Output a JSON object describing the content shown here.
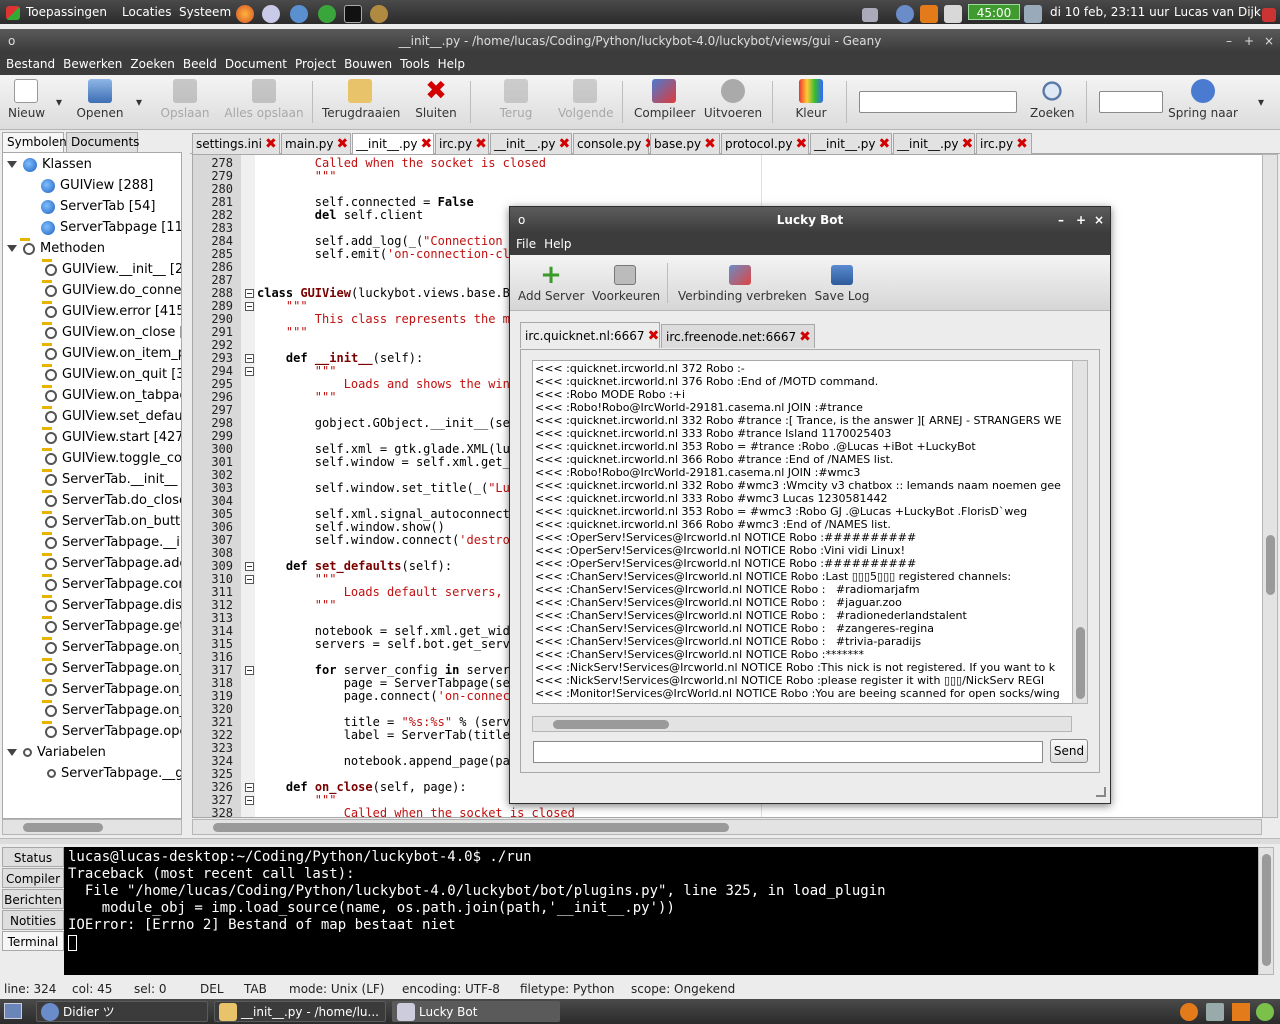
{
  "top_panel": {
    "menus": [
      "Toepassingen",
      "Locaties",
      "Systeem"
    ],
    "battery": "45:00",
    "clock": "di 10 feb, 23:11 uur",
    "user": "Lucas van Dijk"
  },
  "geany": {
    "title": "__init__.py - /home/lucas/Coding/Python/luckybot-4.0/luckybot/views/gui - Geany",
    "menu": [
      "Bestand",
      "Bewerken",
      "Zoeken",
      "Beeld",
      "Document",
      "Project",
      "Bouwen",
      "Tools",
      "Help"
    ],
    "toolbar": {
      "nieuw": "Nieuw",
      "openen": "Openen",
      "opslaan": "Opslaan",
      "alles_opslaan": "Alles opslaan",
      "terugdraaien": "Terugdraaien",
      "sluiten": "Sluiten",
      "terug": "Terug",
      "volgende": "Volgende",
      "compileer": "Compileer",
      "uitvoeren": "Uitvoeren",
      "kleur": "Kleur",
      "zoeken": "Zoeken",
      "spring_naar": "Spring naar",
      "search_value": "",
      "jump_value": ""
    },
    "side_tabs": [
      "Symbolen",
      "Documents"
    ],
    "tree": {
      "klassen": "Klassen",
      "classes": [
        "GUIView [288]",
        "ServerTab [54]",
        "ServerTabpage [11"
      ],
      "methoden": "Methoden",
      "methods": [
        "GUIView.__init__ [29",
        "GUIView.do_connec",
        "GUIView.error [415]",
        "GUIView.on_close [3",
        "GUIView.on_item_pr",
        "GUIView.on_quit [37",
        "GUIView.on_tabpag",
        "GUIView.set_default",
        "GUIView.start [427]",
        "GUIView.toggle_con",
        "ServerTab.__init__ [5",
        "ServerTab.do_close",
        "ServerTab.on_butto",
        "ServerTabpage.__in",
        "ServerTabpage.add",
        "ServerTabpage.con",
        "ServerTabpage.disc",
        "ServerTabpage.get_",
        "ServerTabpage.on_",
        "ServerTabpage.on_",
        "ServerTabpage.on_",
        "ServerTabpage.on_",
        "ServerTabpage.ope"
      ],
      "variabelen": "Variabelen",
      "variables": [
        "ServerTabpage.__gs"
      ]
    },
    "file_tabs": [
      "settings.ini",
      "main.py",
      "__init__.py",
      "irc.py",
      "__init__.py",
      "console.py",
      "base.py",
      "protocol.py",
      "__init__.py",
      "__init__.py",
      "irc.py"
    ],
    "active_tab": 2,
    "line_numbers": [
      "278",
      "279",
      "280",
      "281",
      "282",
      "283",
      "284",
      "285",
      "286",
      "287",
      "288",
      "289",
      "290",
      "291",
      "292",
      "293",
      "294",
      "295",
      "296",
      "297",
      "298",
      "299",
      "300",
      "301",
      "302",
      "303",
      "304",
      "305",
      "306",
      "307",
      "308",
      "309",
      "310",
      "311",
      "312",
      "313",
      "314",
      "315",
      "316",
      "317",
      "318",
      "319",
      "320",
      "321",
      "322",
      "323",
      "324",
      "325",
      "326",
      "327",
      "328"
    ],
    "code": [
      [
        {
          "t": "        Called when the socket is closed",
          "c": "doc"
        }
      ],
      [
        {
          "t": "        \"\"\"",
          "c": "doc"
        }
      ],
      [],
      [
        {
          "t": "        self.connected = "
        },
        {
          "t": "False",
          "c": "kw"
        }
      ],
      [
        {
          "t": "        "
        },
        {
          "t": "del",
          "c": "kw"
        },
        {
          "t": " self.client"
        }
      ],
      [],
      [
        {
          "t": "        self.add_log(_("
        },
        {
          "t": "\"Connection C",
          "c": "str"
        }
      ],
      [
        {
          "t": "        self.emit("
        },
        {
          "t": "'on-connection-clo",
          "c": "str"
        }
      ],
      [],
      [],
      [
        {
          "t": "class",
          "c": "kw"
        },
        {
          "t": " "
        },
        {
          "t": "GUIView",
          "c": "cls"
        },
        {
          "t": "(luckybot.views.base.Ba"
        }
      ],
      [
        {
          "t": "    \"\"\"",
          "c": "doc"
        }
      ],
      [
        {
          "t": "        This class represents the ma",
          "c": "doc"
        }
      ],
      [
        {
          "t": "    \"\"\"",
          "c": "doc"
        }
      ],
      [],
      [
        {
          "t": "    "
        },
        {
          "t": "def",
          "c": "kw"
        },
        {
          "t": " "
        },
        {
          "t": "__init__",
          "c": "fn"
        },
        {
          "t": "(self):"
        }
      ],
      [
        {
          "t": "        \"\"\"",
          "c": "doc"
        }
      ],
      [
        {
          "t": "            Loads and shows the wind",
          "c": "doc"
        }
      ],
      [
        {
          "t": "        \"\"\"",
          "c": "doc"
        }
      ],
      [],
      [
        {
          "t": "        gobject.GObject.__init__(sel"
        }
      ],
      [],
      [
        {
          "t": "        self.xml = gtk.glade.XML(luc"
        }
      ],
      [
        {
          "t": "        self.window = self.xml.get_w"
        }
      ],
      [],
      [
        {
          "t": "        self.window.set_title(_("
        },
        {
          "t": "\"Luc",
          "c": "str"
        }
      ],
      [],
      [
        {
          "t": "        self.xml.signal_autoconnect("
        }
      ],
      [
        {
          "t": "        self.window.show()"
        }
      ],
      [
        {
          "t": "        self.window.connect("
        },
        {
          "t": "'destroy",
          "c": "str"
        }
      ],
      [],
      [
        {
          "t": "    "
        },
        {
          "t": "def",
          "c": "kw"
        },
        {
          "t": " "
        },
        {
          "t": "set_defaults",
          "c": "fn"
        },
        {
          "t": "(self):"
        }
      ],
      [
        {
          "t": "        \"\"\"",
          "c": "doc"
        }
      ],
      [
        {
          "t": "            Loads default servers, a",
          "c": "doc"
        }
      ],
      [
        {
          "t": "        \"\"\"",
          "c": "doc"
        }
      ],
      [],
      [
        {
          "t": "        notebook = self.xml.get_widg"
        }
      ],
      [
        {
          "t": "        servers = self.bot.get_serve"
        }
      ],
      [],
      [
        {
          "t": "        "
        },
        {
          "t": "for",
          "c": "kw"
        },
        {
          "t": " server_config "
        },
        {
          "t": "in",
          "c": "kw"
        },
        {
          "t": " servers"
        }
      ],
      [
        {
          "t": "            page = ServerTabpage(ser"
        }
      ],
      [
        {
          "t": "            page.connect("
        },
        {
          "t": "'on-connect",
          "c": "str"
        }
      ],
      [],
      [
        {
          "t": "            title = "
        },
        {
          "t": "\"%s:%s\"",
          "c": "str"
        },
        {
          "t": " % (serve"
        }
      ],
      [
        {
          "t": "            label = ServerTab(title,"
        }
      ],
      [],
      [
        {
          "t": "            notebook.append_page(pag"
        }
      ],
      [],
      [
        {
          "t": "    "
        },
        {
          "t": "def",
          "c": "kw"
        },
        {
          "t": " "
        },
        {
          "t": "on_close",
          "c": "fn"
        },
        {
          "t": "(self, page):"
        }
      ],
      [
        {
          "t": "        \"\"\"",
          "c": "doc"
        }
      ],
      [
        {
          "t": "            Called when the socket is closed",
          "c": "doc"
        }
      ]
    ],
    "msg_tabs": [
      "Status",
      "Compiler",
      "Berichten",
      "Notities",
      "Terminal"
    ],
    "terminal": [
      "lucas@lucas-desktop:~/Coding/Python/luckybot-4.0$ ./run",
      "Traceback (most recent call last):",
      "  File \"/home/lucas/Coding/Python/luckybot-4.0/luckybot/bot/plugins.py\", line 325, in load_plugin",
      "    module_obj = imp.load_source(name, os.path.join(path,'__init__.py'))",
      "IOError: [Errno 2] Bestand of map bestaat niet"
    ],
    "status": {
      "line": "line: 324",
      "col": "col: 45",
      "sel": "sel: 0",
      "del": "DEL",
      "tab": "TAB",
      "mode": "mode: Unix (LF)",
      "encoding": "encoding: UTF-8",
      "filetype": "filetype: Python",
      "scope": "scope: Ongekend"
    }
  },
  "luckybot": {
    "title": "Lucky Bot",
    "menu": [
      "File",
      "Help"
    ],
    "toolbar": {
      "add_server": "Add Server",
      "voorkeuren": "Voorkeuren",
      "verbinding_verbreken": "Verbinding verbreken",
      "save_log": "Save Log"
    },
    "tabs": [
      "irc.quicknet.nl:6667",
      "irc.freenode.net:6667"
    ],
    "log": [
      "<<< :quicknet.ircworld.nl 372 Robo :-",
      "<<< :quicknet.ircworld.nl 376 Robo :End of /MOTD command.",
      "<<< :Robo MODE Robo :+i",
      "<<< :Robo!Robo@IrcWorld-29181.casema.nl JOIN :#trance",
      "<<< :quicknet.ircworld.nl 332 Robo #trance :[ Trance, is the answer ][ ARNEJ - STRANGERS WE",
      "<<< :quicknet.ircworld.nl 333 Robo #trance Island 1170025403",
      "<<< :quicknet.ircworld.nl 353 Robo = #trance :Robo .@Lucas +iBot +LuckyBot",
      "<<< :quicknet.ircworld.nl 366 Robo #trance :End of /NAMES list.",
      "<<< :Robo!Robo@IrcWorld-29181.casema.nl JOIN :#wmc3",
      "<<< :quicknet.ircworld.nl 332 Robo #wmc3 :Wmcity v3 chatbox :: Iemands naam noemen gee",
      "<<< :quicknet.ircworld.nl 333 Robo #wmc3 Lucas 1230581442",
      "<<< :quicknet.ircworld.nl 353 Robo = #wmc3 :Robo GJ .@Lucas +LuckyBot .FlorisD`weg",
      "<<< :quicknet.ircworld.nl 366 Robo #wmc3 :End of /NAMES list.",
      "<<< :OperServ!Services@Ircworld.nl NOTICE Robo :##########",
      "<<< :OperServ!Services@Ircworld.nl NOTICE Robo :Vini vidi Linux!",
      "<<< :OperServ!Services@Ircworld.nl NOTICE Robo :##########",
      "<<< :ChanServ!Services@Ircworld.nl NOTICE Robo :Last ▯▯▯5▯▯▯ registered channels:",
      "<<< :ChanServ!Services@Ircworld.nl NOTICE Robo :   #radiomarjafm",
      "<<< :ChanServ!Services@Ircworld.nl NOTICE Robo :   #jaguar.zoo",
      "<<< :ChanServ!Services@Ircworld.nl NOTICE Robo :   #radionederlandstalent",
      "<<< :ChanServ!Services@Ircworld.nl NOTICE Robo :   #zangeres-regina",
      "<<< :ChanServ!Services@Ircworld.nl NOTICE Robo :   #trivia-paradijs",
      "<<< :ChanServ!Services@Ircworld.nl NOTICE Robo :*******",
      "<<< :NickServ!Services@Ircworld.nl NOTICE Robo :This nick is not registered. If you want to k",
      "<<< :NickServ!Services@Ircworld.nl NOTICE Robo :please register it with ▯▯▯/NickServ REGI",
      "<<< :Monitor!Services@IrcWorld.nl NOTICE Robo :You are beeing scanned for open socks/wing"
    ],
    "message_value": "",
    "send_label": "Send"
  },
  "taskbar": {
    "items": [
      "Didier ツ",
      "__init__.py - /home/lu...",
      "Lucky Bot"
    ]
  },
  "colors": {
    "accent_red": "#d20000",
    "panel": "#3c3c3c"
  }
}
